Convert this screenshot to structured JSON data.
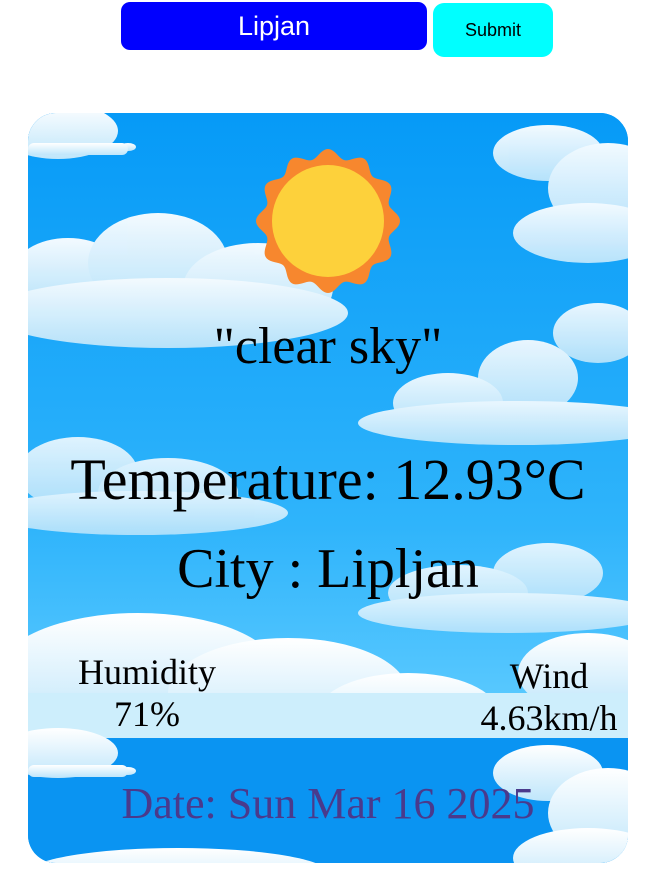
{
  "search": {
    "value": "Lipjan",
    "submit_label": "Submit"
  },
  "weather": {
    "icon": "sun-icon",
    "description": "\"clear sky\"",
    "temperature": "Temperature: 12.93°C",
    "city": "City : Lipljan",
    "humidity_label": "Humidity",
    "humidity_value": "71%",
    "wind_label": "Wind",
    "wind_value": "4.63km/h",
    "date": "Date: Sun Mar 16 2025"
  },
  "colors": {
    "input_bg": "#0000ff",
    "submit_bg": "#00ffff",
    "sky": "#0a93f0",
    "sun_outer": "#f7872e",
    "sun_inner": "#fdd13b",
    "date_text": "#4a3a8c"
  }
}
